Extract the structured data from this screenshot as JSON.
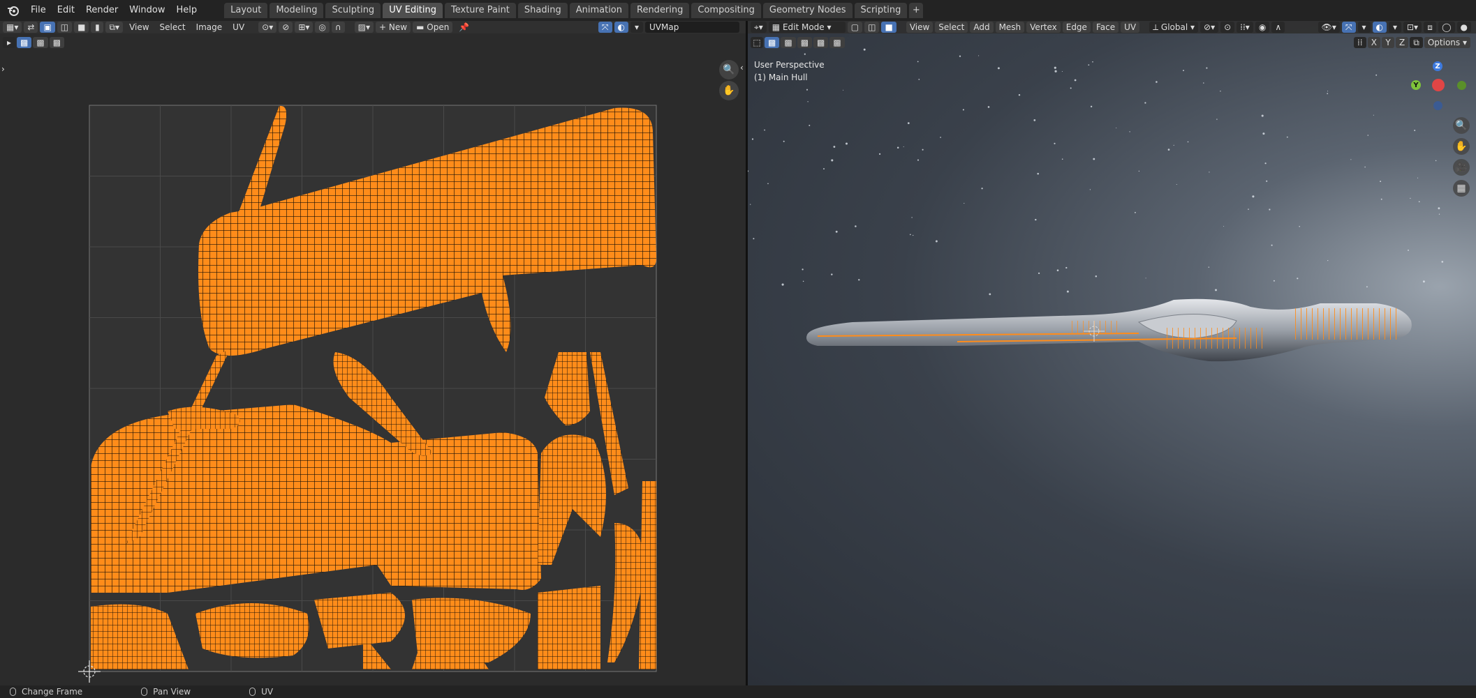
{
  "menu": {
    "file": "File",
    "edit": "Edit",
    "render": "Render",
    "window": "Window",
    "help": "Help"
  },
  "workspaces": [
    "Layout",
    "Modeling",
    "Sculpting",
    "UV Editing",
    "Texture Paint",
    "Shading",
    "Animation",
    "Rendering",
    "Compositing",
    "Geometry Nodes",
    "Scripting"
  ],
  "active_workspace": "UV Editing",
  "uv_editor": {
    "menus": {
      "view": "View",
      "select": "Select",
      "image": "Image",
      "uv": "UV"
    },
    "new_label": "New",
    "open_label": "Open",
    "uv_map": "UVMap"
  },
  "viewport": {
    "mode": "Edit Mode",
    "menus": {
      "view": "View",
      "select": "Select",
      "add": "Add",
      "mesh": "Mesh",
      "vertex": "Vertex",
      "edge": "Edge",
      "face": "Face",
      "uv": "UV"
    },
    "orientation": "Global",
    "axis_x": "X",
    "axis_y": "Y",
    "axis_z": "Z",
    "options": "Options",
    "perspective": "User Perspective",
    "object": "(1) Main Hull",
    "gizmo": {
      "z": "Z",
      "y": "Y"
    }
  },
  "status": {
    "left": "Change Frame",
    "middle": "Pan View",
    "right": "UV"
  },
  "colors": {
    "accent": "#4772b3",
    "uv_orange": "#ff8c1a",
    "bg_uv": "#2b2b2b"
  }
}
